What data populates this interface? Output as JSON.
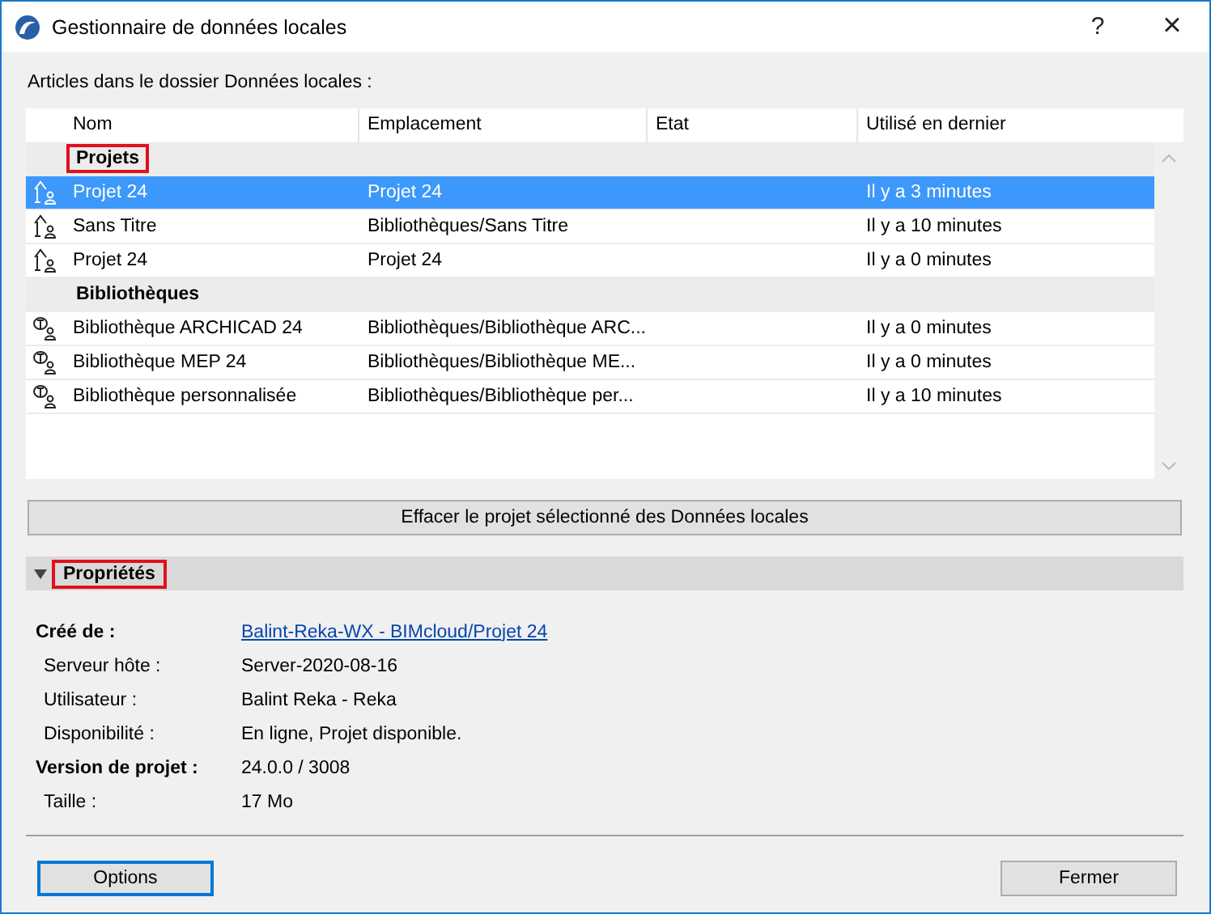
{
  "window": {
    "title": "Gestionnaire de données locales",
    "help": "?",
    "close": "×"
  },
  "list_label": "Articles dans le dossier Données locales :",
  "table": {
    "columns": [
      "Nom",
      "Emplacement",
      "Etat",
      "Utilisé en dernier"
    ],
    "rows": [
      {
        "kind": "group",
        "name": "Projets",
        "highlighted": true
      },
      {
        "kind": "project",
        "name": "Projet 24",
        "location": "Projet 24",
        "last_used": "Il y a 3 minutes",
        "selected": true
      },
      {
        "kind": "project",
        "name": "Sans Titre",
        "location": "Bibliothèques/Sans Titre",
        "last_used": "Il y a 10 minutes",
        "selected": false
      },
      {
        "kind": "project",
        "name": "Projet 24",
        "location": "Projet 24",
        "last_used": "Il y a 0 minutes",
        "selected": false
      },
      {
        "kind": "group",
        "name": "Bibliothèques",
        "highlighted": false
      },
      {
        "kind": "library",
        "name": "Bibliothèque ARCHICAD 24",
        "location": "Bibliothèques/Bibliothèque ARC...",
        "last_used": "Il y a 0 minutes",
        "selected": false
      },
      {
        "kind": "library",
        "name": "Bibliothèque MEP 24",
        "location": "Bibliothèques/Bibliothèque ME...",
        "last_used": "Il y a 0 minutes",
        "selected": false
      },
      {
        "kind": "library",
        "name": "Bibliothèque personnalisée",
        "location": "Bibliothèques/Bibliothèque per...",
        "last_used": "Il y a 10 minutes",
        "selected": false
      }
    ]
  },
  "delete_button": "Effacer le projet sélectionné des Données locales",
  "properties": {
    "title": "Propriétés",
    "expanded": true,
    "highlighted": true,
    "items": [
      {
        "kind": "heading",
        "label": "Créé de :",
        "value": "Balint-Reka-WX - BIMcloud/Projet 24",
        "link": true
      },
      {
        "kind": "detail",
        "label": "Serveur hôte :",
        "value": "Server-2020-08-16",
        "link": false
      },
      {
        "kind": "detail",
        "label": "Utilisateur :",
        "value": "Balint Reka - Reka",
        "link": false
      },
      {
        "kind": "detail",
        "label": "Disponibilité :",
        "value": "En ligne, Projet disponible.",
        "link": false
      },
      {
        "kind": "heading",
        "label": "Version de projet :",
        "value": "24.0.0 / 3008",
        "link": false
      },
      {
        "kind": "detail",
        "label": "Taille :",
        "value": "17 Mo",
        "link": false
      }
    ]
  },
  "buttons": [
    {
      "label": "Options",
      "default": true
    },
    {
      "label": "Fermer",
      "default": false
    }
  ]
}
